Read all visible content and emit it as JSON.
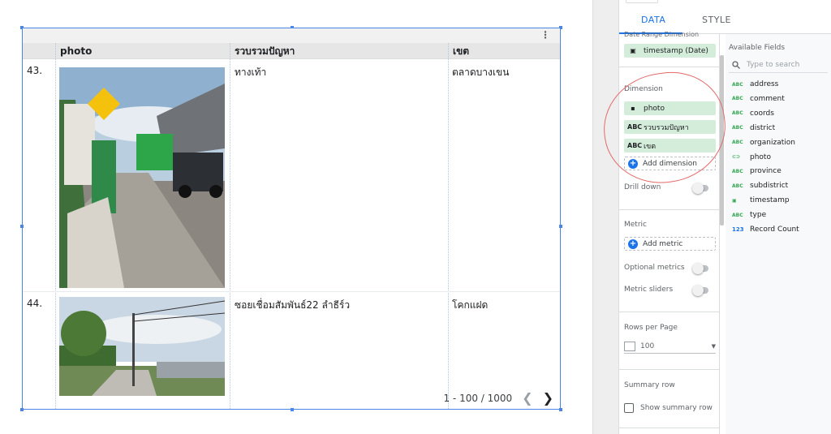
{
  "table": {
    "columns": [
      "photo",
      "รวบรวมปัญหา",
      "เขต"
    ],
    "rows": [
      {
        "num": "43.",
        "problem": "ทางเท้า",
        "district": "ตลาดบางเขน"
      },
      {
        "num": "44.",
        "problem": "ซอยเชื่อมสัมพันธ์22 ลำธีร์ว",
        "district": "โคกแฝด"
      }
    ],
    "pagination": "1 - 100 / 1000",
    "prev_icon": "chevron-left-icon",
    "next_icon": "chevron-right-icon"
  },
  "panel": {
    "tabs": [
      "DATA",
      "STYLE"
    ],
    "date_range_label": "Date Range Dimension",
    "date_range_value": "timestamp (Date)",
    "dimension_label": "Dimension",
    "dimensions": [
      {
        "type": "image",
        "name": "photo"
      },
      {
        "type": "ABC",
        "name": "รวบรวมปัญหา"
      },
      {
        "type": "ABC",
        "name": "เขต"
      }
    ],
    "add_dimension": "Add dimension",
    "drill_down": "Drill down",
    "metric_label": "Metric",
    "add_metric": "Add metric",
    "optional_metrics": "Optional metrics",
    "metric_sliders": "Metric sliders",
    "rows_per_page_label": "Rows per Page",
    "rows_per_page_value": "100",
    "summary_row_label": "Summary row",
    "show_summary_row": "Show summary row"
  },
  "available": {
    "title": "Available Fields",
    "search_placeholder": "Type to search",
    "fields": [
      {
        "type": "ABC",
        "name": "address"
      },
      {
        "type": "ABC",
        "name": "comment"
      },
      {
        "type": "ABC",
        "name": "coords"
      },
      {
        "type": "ABC",
        "name": "district"
      },
      {
        "type": "ABC",
        "name": "organization"
      },
      {
        "type": "link",
        "name": "photo"
      },
      {
        "type": "ABC",
        "name": "province"
      },
      {
        "type": "ABC",
        "name": "subdistrict"
      },
      {
        "type": "date",
        "name": "timestamp"
      },
      {
        "type": "ABC",
        "name": "type"
      },
      {
        "type": "123",
        "name": "Record Count"
      }
    ]
  }
}
